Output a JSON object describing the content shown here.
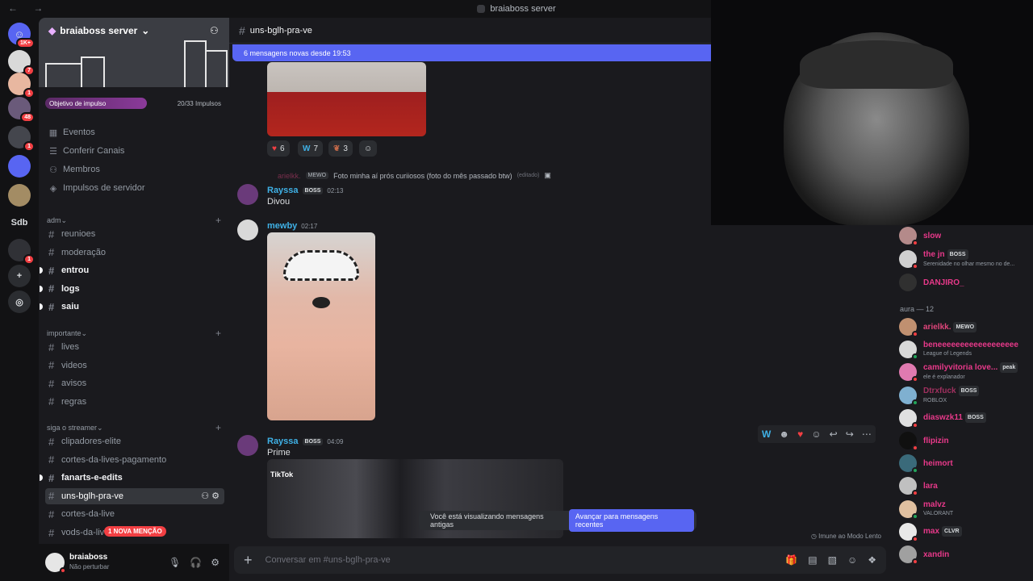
{
  "titlebar": {
    "title": "braiaboss server"
  },
  "rail": {
    "top_badge": "1K+",
    "servers": [
      {
        "badge": "7",
        "color": "#d9d9d9"
      },
      {
        "badge": "1",
        "color": "#e8b7a0"
      },
      {
        "badge": "48",
        "color": "#6a5a7a"
      },
      {
        "badge": "1",
        "color": "#44464d"
      },
      {
        "badge": "",
        "color": "#5865f2"
      },
      {
        "badge": "",
        "color": "#a38c64"
      },
      {
        "badge": "",
        "label": "Sdb",
        "color": "#121214"
      },
      {
        "badge": "1",
        "color": "#303136"
      }
    ]
  },
  "sidebar": {
    "server_name": "braiaboss server",
    "boost_label": "Objetivo de impulso",
    "boost_count": "20/33 Impulsos",
    "items": [
      {
        "label": "Eventos",
        "icon": "calendar-icon"
      },
      {
        "label": "Conferir Canais",
        "icon": "browse-icon"
      },
      {
        "label": "Membros",
        "icon": "members-icon"
      },
      {
        "label": "Impulsos de servidor",
        "icon": "boost-icon"
      }
    ],
    "categories": [
      {
        "name": "adm",
        "channels": [
          {
            "name": "reunioes",
            "unread": false
          },
          {
            "name": "moderação",
            "unread": false
          },
          {
            "name": "entrou",
            "unread": true
          },
          {
            "name": "logs",
            "unread": true
          },
          {
            "name": "saiu",
            "unread": true
          }
        ]
      },
      {
        "name": "importante",
        "channels": [
          {
            "name": "lives",
            "unread": false
          },
          {
            "name": "videos",
            "unread": false
          },
          {
            "name": "avisos",
            "unread": false
          },
          {
            "name": "regras",
            "unread": false
          }
        ]
      },
      {
        "name": "siga o streamer",
        "channels": [
          {
            "name": "clipadores-elite",
            "unread": false
          },
          {
            "name": "cortes-da-lives-pagamento",
            "unread": false
          },
          {
            "name": "fanarts-e-edits",
            "unread": true
          },
          {
            "name": "uns-bglh-pra-ve",
            "unread": false,
            "active": true
          },
          {
            "name": "cortes-da-live",
            "unread": false
          },
          {
            "name": "vods-da-liv",
            "unread": false
          }
        ]
      }
    ],
    "mention_badge": "1 NOVA MENÇÃO",
    "user": {
      "name": "braiaboss",
      "status": "Não perturbar"
    }
  },
  "chat": {
    "channel": "uns-bglh-pra-ve",
    "new_messages_bar": "6 mensagens novas desde 19:53",
    "reactions": [
      {
        "emoji": "heart",
        "count": "6"
      },
      {
        "emoji": "W",
        "count": "7"
      },
      {
        "emoji": "custom",
        "count": "3"
      }
    ],
    "reply": {
      "author": "arielkk.",
      "tag": "MEWO",
      "text": "Foto minha aí prós curiiosos (foto do mês passado btw)",
      "edited": "(editado)"
    },
    "messages": [
      {
        "author": "Rayssa",
        "tag": "BOSS",
        "time": "02:13",
        "text": "Divou",
        "color": "#3fb1e6"
      },
      {
        "author": "mewby",
        "tag": "",
        "time": "02:17",
        "text": "",
        "color": "#3fb1e6"
      },
      {
        "author": "Rayssa",
        "tag": "BOSS",
        "time": "04:09",
        "text": "Prime",
        "color": "#3fb1e6"
      }
    ],
    "tiktok_label": "TikTok",
    "old_messages_text": "Você está visualizando mensagens antigas",
    "jump_button": "Avançar para mensagens recentes",
    "slowmode": "Imune ao Modo Lento",
    "composer_placeholder": "Conversar em #uns-bglh-pra-ve"
  },
  "members": {
    "list_top": [
      {
        "name": "slow",
        "sub": "",
        "tag": "",
        "color": "#e8398a",
        "status": "#f23f43"
      },
      {
        "name": "the jn",
        "sub": "Serenidade no olhar mesmo no de...",
        "tag": "BOSS",
        "color": "#e8398a",
        "status": "#f23f43"
      },
      {
        "name": "DANJIRO_",
        "sub": "",
        "tag": "",
        "color": "#e8398a",
        "status": ""
      }
    ],
    "group_label": "aura — 12",
    "list": [
      {
        "name": "arielkk.",
        "sub": "",
        "tag": "MEWO",
        "color": "#e0457b",
        "status": "#f23f43"
      },
      {
        "name": "beneeeeeeeeeeeeeeeeee",
        "sub": "League of Legends",
        "tag": "",
        "color": "#e8398a",
        "status": "#23a55a"
      },
      {
        "name": "camilyvitoria love...",
        "sub": "ele é explanador",
        "tag": "peak",
        "color": "#e8398a",
        "status": "#f23f43"
      },
      {
        "name": "Dtrxfuck",
        "sub": "ROBLOX",
        "tag": "BOSS",
        "color": "#a0305f",
        "status": "#23a55a"
      },
      {
        "name": "diaswzk11",
        "sub": "",
        "tag": "BOSS",
        "color": "#e8398a",
        "status": "#f23f43"
      },
      {
        "name": "flipizin",
        "sub": "",
        "tag": "",
        "color": "#e8398a",
        "status": "#f23f43"
      },
      {
        "name": "heimort",
        "sub": "",
        "tag": "",
        "color": "#e8398a",
        "status": "#23a55a"
      },
      {
        "name": "lara",
        "sub": "",
        "tag": "",
        "color": "#e8398a",
        "status": "#f23f43"
      },
      {
        "name": "malvz",
        "sub": "VALORANT",
        "tag": "",
        "color": "#e8398a",
        "status": "#23a55a"
      },
      {
        "name": "max",
        "sub": "",
        "tag": "CLVR",
        "color": "#e8398a",
        "status": "#f23f43"
      },
      {
        "name": "xandin",
        "sub": "",
        "tag": "",
        "color": "#e8398a",
        "status": "#f23f43"
      }
    ]
  }
}
